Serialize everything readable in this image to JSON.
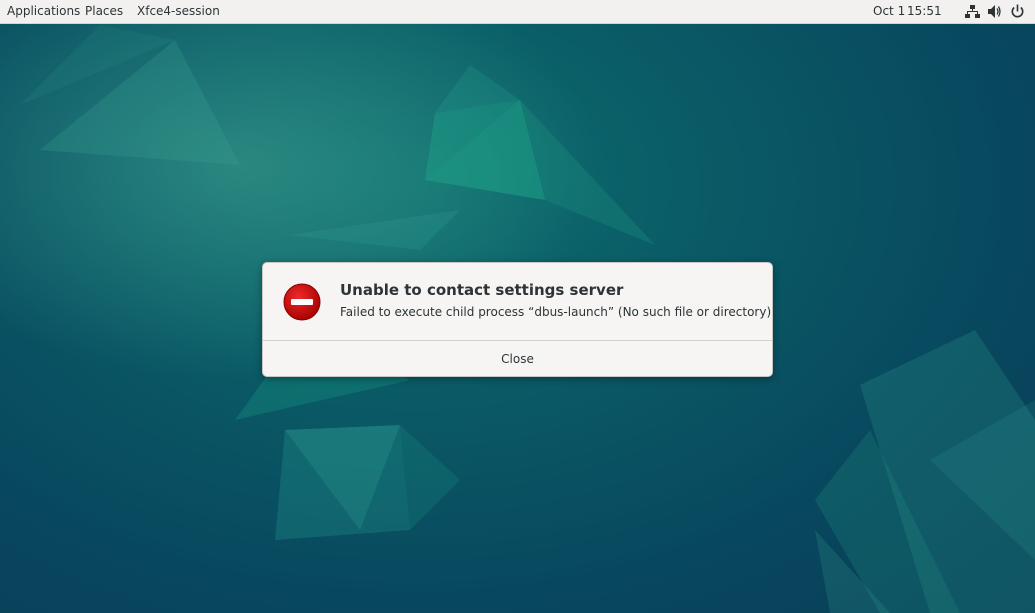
{
  "topbar": {
    "applications_label": "Applications",
    "places_label": "Places",
    "app_label": "Xfce4-session",
    "date": "Oct 1",
    "time": "15:51",
    "tray_icons": [
      "network-icon",
      "volume-icon",
      "power-icon"
    ]
  },
  "dialog": {
    "icon": "error-icon",
    "title": "Unable to contact settings server",
    "message": "Failed to execute child process “dbus-launch” (No such file or directory)",
    "close_label": "Close"
  },
  "colors": {
    "wallpaper_base": "#08475e",
    "wallpaper_accent": "#1a9a86",
    "error_red": "#cc0000",
    "topbar_bg": "#f2f1ef"
  }
}
